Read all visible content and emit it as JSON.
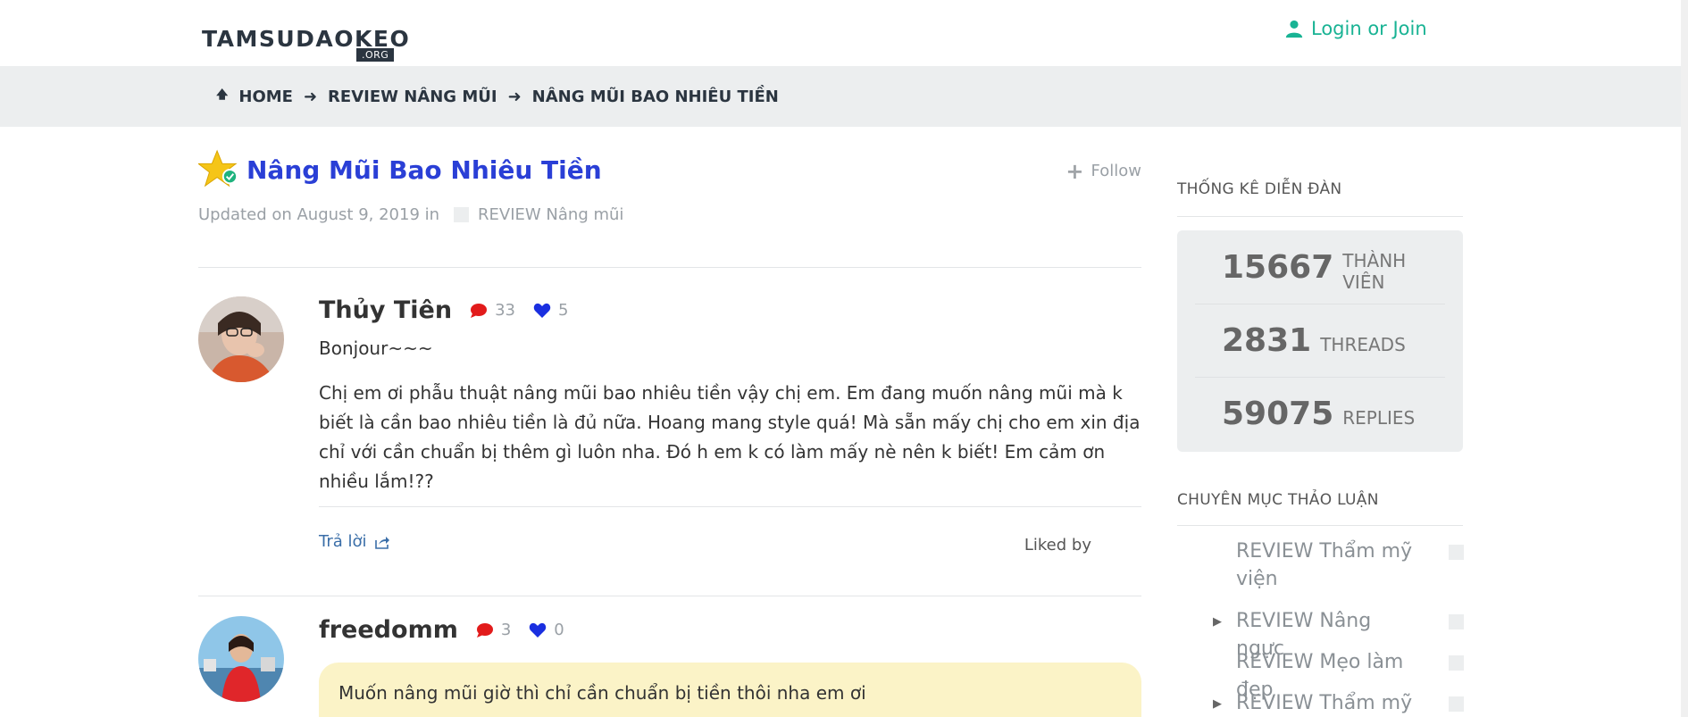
{
  "header": {
    "logo_main": "TAMSUDAOKEO",
    "logo_sub": ".ORG",
    "login_label": "Login or Join"
  },
  "breadcrumb": {
    "items": [
      "HOME",
      "REVIEW NÂNG MŨI",
      "NÂNG MŨI BAO NHIÊU TIỀN"
    ]
  },
  "thread": {
    "title": "Nâng Mũi Bao Nhiêu Tiền",
    "follow_label": "Follow",
    "meta_prefix": "Updated on August 9, 2019 in",
    "category": "REVIEW Nâng mũi"
  },
  "posts": [
    {
      "author": "Thủy Tiên",
      "comments": "33",
      "likes": "5",
      "greeting": "Bonjour~~~",
      "body": "Chị em ơi phẫu thuật nâng mũi bao nhiêu tiền vậy chị em. Em đang muốn nâng mũi mà k biết là cần bao nhiêu tiền là đủ nữa. Hoang mang style quá! Mà sẵn mấy chị cho em xin địa chỉ với cần chuẩn bị thêm gì luôn nha. Đó h em k có làm mấy nè nên k biết! Em cảm ơn nhiều lắm!??",
      "reply_label": "Trả lời",
      "liked_by_label": "Liked by"
    },
    {
      "author": "freedomm",
      "comments": "3",
      "likes": "0",
      "body": "Muốn nâng mũi giờ thì chỉ cần chuẩn bị tiền thôi nha em ơi"
    }
  ],
  "sidebar": {
    "stats_heading": "THỐNG KÊ DIỄN ĐÀN",
    "stats": [
      {
        "num": "15667",
        "label": "THÀNH VIÊN"
      },
      {
        "num": "2831",
        "label": "THREADS"
      },
      {
        "num": "59075",
        "label": "REPLIES"
      }
    ],
    "categories_heading": "CHUYÊN MỤC THẢO LUẬN",
    "categories": [
      {
        "label": "REVIEW Thẩm mỹ viện",
        "has_children": false
      },
      {
        "label": "REVIEW Nâng ngực",
        "has_children": true
      },
      {
        "label": "REVIEW Mẹo làm đẹp",
        "has_children": false
      },
      {
        "label": "REVIEW Thẩm mỹ",
        "has_children": true
      }
    ]
  },
  "colors": {
    "accent_teal": "#19b394",
    "title_blue": "#2a3fd6",
    "comment_red": "#e21b1b",
    "like_blue": "#1a2fe0",
    "quote_bg": "#fbf3c7"
  }
}
